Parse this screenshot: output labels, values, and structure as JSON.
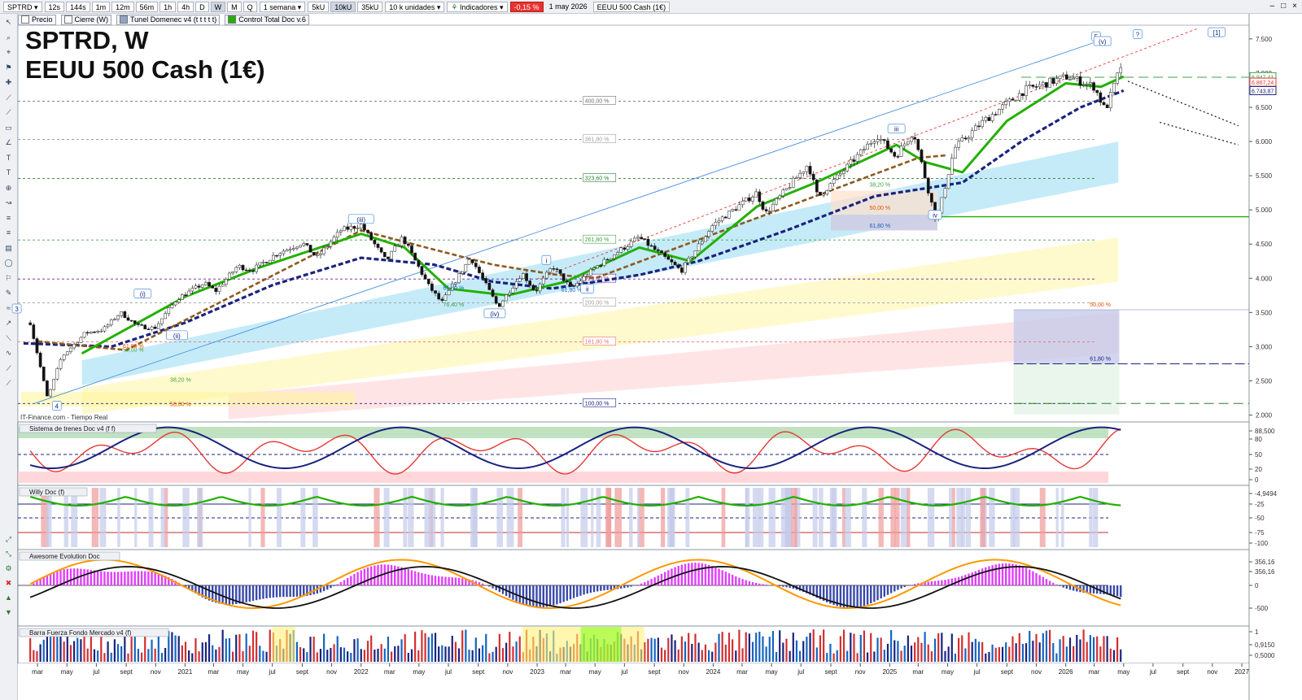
{
  "toolbar": {
    "symbol": "SPTRD",
    "timeframes": [
      "12s",
      "144s",
      "1m",
      "12m",
      "56m",
      "1h",
      "4h",
      "D",
      "W",
      "M",
      "Q"
    ],
    "period": "1 semana",
    "units": [
      "5kU",
      "10kU",
      "35kU"
    ],
    "quantity": "10 k unidades",
    "indicators": "Indicadores",
    "change": "-0,15 %",
    "date": "1 may 2026",
    "instrument": "EEUU 500 Cash (1€)"
  },
  "legend": {
    "items": [
      "Precio",
      "Cierre (W)",
      "Tunel Domenec v4 (t t t t t)",
      "Control Total Doc v.6"
    ]
  },
  "title": {
    "line1": "SPTRD, W",
    "line2": "EEUU 500 Cash (1€)"
  },
  "watermark": "IT-Finance.com - Tiempo Real",
  "panels": {
    "p1": "Sistema de trenes Doc v4 (f f)",
    "p2": "Willy Doc (f)",
    "p3": "Awesome Evolution Doc",
    "p4": "Barra Fuerza Fondo Mercado v4 (f)"
  },
  "colors": {
    "price_up": "#2e7d32",
    "price_down": "#c62828",
    "tunnel_green": "#22b000",
    "tunnel_red": "#e53935",
    "tunnel_blue": "#1a237e",
    "brown": "#8d5a1f",
    "fib_green": "#2e7d32",
    "fib_gray": "#707070",
    "accent_red": "#e8322f"
  },
  "chart_data": {
    "type": "candlestick",
    "timeframe": "W",
    "x_labels": [
      "mar",
      "may",
      "jul",
      "sept",
      "nov",
      "2021",
      "mar",
      "may",
      "jul",
      "sept",
      "nov",
      "2022",
      "mar",
      "may",
      "jul",
      "sept",
      "nov",
      "2023",
      "mar",
      "may",
      "jul",
      "sept",
      "nov",
      "2024",
      "mar",
      "may",
      "jul",
      "sept",
      "nov",
      "2025",
      "mar",
      "may",
      "jul",
      "sept",
      "nov",
      "2026",
      "mar",
      "may",
      "jul",
      "sept",
      "nov",
      "2027"
    ],
    "y_ticks": [
      "7.500",
      "7.000",
      "6.500",
      "6.000",
      "5.500",
      "5.000",
      "4.500",
      "4.000",
      "3.500",
      "3.000",
      "2.500",
      "2.000"
    ],
    "ylim": [
      1900,
      7700
    ],
    "price_path": [
      [
        "2020-02-15",
        3350
      ],
      [
        "2020-03-22",
        2240
      ],
      [
        "2020-04-20",
        2850
      ],
      [
        "2020-06-08",
        3200
      ],
      [
        "2020-07-15",
        3250
      ],
      [
        "2020-08-20",
        3500
      ],
      [
        "2020-09-25",
        3300
      ],
      [
        "2020-10-30",
        3270
      ],
      [
        "2020-12-15",
        3700
      ],
      [
        "2021-02-10",
        3930
      ],
      [
        "2021-03-05",
        3810
      ],
      [
        "2021-04-20",
        4180
      ],
      [
        "2021-05-20",
        4120
      ],
      [
        "2021-07-10",
        4360
      ],
      [
        "2021-09-01",
        4520
      ],
      [
        "2021-10-01",
        4300
      ],
      [
        "2021-11-20",
        4700
      ],
      [
        "2022-01-01",
        4780
      ],
      [
        "2022-02-22",
        4250
      ],
      [
        "2022-03-28",
        4600
      ],
      [
        "2022-05-20",
        3900
      ],
      [
        "2022-06-17",
        3640
      ],
      [
        "2022-08-16",
        4310
      ],
      [
        "2022-10-12",
        3580
      ],
      [
        "2022-12-01",
        4080
      ],
      [
        "2022-12-28",
        3800
      ],
      [
        "2023-02-02",
        4180
      ],
      [
        "2023-03-13",
        3850
      ],
      [
        "2023-04-30",
        4150
      ],
      [
        "2023-07-31",
        4600
      ],
      [
        "2023-10-27",
        4110
      ],
      [
        "2023-12-31",
        4780
      ],
      [
        "2024-03-31",
        5250
      ],
      [
        "2024-04-19",
        4950
      ],
      [
        "2024-07-16",
        5670
      ],
      [
        "2024-08-05",
        5180
      ],
      [
        "2024-12-06",
        6090
      ],
      [
        "2025-01-13",
        5780
      ],
      [
        "2025-02-19",
        6150
      ],
      [
        "2025-04-08",
        4820
      ],
      [
        "2025-05-15",
        5900
      ],
      [
        "2025-07-15",
        6300
      ],
      [
        "2025-10-08",
        6750
      ],
      [
        "2026-01-05",
        6950
      ],
      [
        "2026-03-01",
        6800
      ],
      [
        "2026-03-24",
        6450
      ],
      [
        "2026-04-08",
        6750
      ],
      [
        "2026-05-01",
        7220
      ]
    ],
    "tunnel": {
      "green_ema": [
        [
          "2020-06-01",
          2900
        ],
        [
          "2021-01-01",
          3730
        ],
        [
          "2021-06-01",
          4150
        ],
        [
          "2022-01-01",
          4650
        ],
        [
          "2022-04-01",
          4450
        ],
        [
          "2022-07-01",
          3850
        ],
        [
          "2022-11-01",
          3750
        ],
        [
          "2023-03-01",
          3950
        ],
        [
          "2023-08-01",
          4450
        ],
        [
          "2023-11-15",
          4250
        ],
        [
          "2024-04-01",
          5050
        ],
        [
          "2024-08-01",
          5400
        ],
        [
          "2025-01-15",
          5950
        ],
        [
          "2025-03-15",
          5700
        ],
        [
          "2025-06-01",
          5550
        ],
        [
          "2025-09-01",
          6300
        ],
        [
          "2026-01-01",
          6850
        ],
        [
          "2026-03-15",
          6800
        ],
        [
          "2026-05-01",
          6950
        ]
      ],
      "blue_sma": [
        [
          "2020-02-01",
          3050
        ],
        [
          "2020-08-01",
          3000
        ],
        [
          "2021-01-01",
          3350
        ],
        [
          "2021-07-01",
          3900
        ],
        [
          "2022-01-01",
          4300
        ],
        [
          "2022-06-01",
          4200
        ],
        [
          "2022-10-01",
          3950
        ],
        [
          "2023-02-01",
          3850
        ],
        [
          "2023-08-01",
          4050
        ],
        [
          "2023-12-01",
          4250
        ],
        [
          "2024-06-01",
          4700
        ],
        [
          "2024-12-01",
          5200
        ],
        [
          "2025-06-01",
          5400
        ],
        [
          "2025-10-01",
          6000
        ],
        [
          "2026-02-01",
          6500
        ],
        [
          "2026-05-01",
          6744
        ]
      ],
      "brown_ma": [
        [
          "2020-03-01",
          3080
        ],
        [
          "2020-09-01",
          2950
        ],
        [
          "2022-01-01",
          4700
        ],
        [
          "2022-06-01",
          4420
        ],
        [
          "2022-10-01",
          4200
        ],
        [
          "2023-02-01",
          4060
        ],
        [
          "2023-05-01",
          4000
        ],
        [
          "2025-03-01",
          5760
        ],
        [
          "2025-05-01",
          5800
        ]
      ]
    },
    "fib_levels": [
      {
        "label": "400,00 %",
        "value": 6590,
        "color": "#707070"
      },
      {
        "label": "361,80 %",
        "value": 6030,
        "color": "#9e9e9e"
      },
      {
        "label": "323,60 %",
        "value": 5460,
        "color": "#2e7d32"
      },
      {
        "label": "261,80 %",
        "value": 4560,
        "color": "#43a047"
      },
      {
        "label": "223,60 %",
        "value": 3990,
        "color": "#6a1b9a"
      },
      {
        "label": "200,00 %",
        "value": 3640,
        "color": "#9e9e9e"
      },
      {
        "label": "161,80 %",
        "value": 3070,
        "color": "#e57373"
      },
      {
        "label": "100,00 %",
        "value": 2170,
        "color": "#1a237e"
      }
    ],
    "extra_labels": [
      "61,80 %",
      "76,40 %",
      "38,20 %",
      "50,00 %",
      "50,00 %",
      "61,80 %",
      "38,20 %",
      "50,00 %",
      "61,80 %",
      "61,80 %"
    ],
    "wave_labels": [
      "3",
      "4",
      "(i)",
      "(ii)",
      "(iii)",
      "(iv)",
      "i",
      "ii",
      "iii",
      "iv",
      "5",
      "(v)",
      "?",
      "[1]"
    ],
    "right_labels": [
      "6.947,41",
      "6.867,24",
      "6.743,87"
    ],
    "target_green": 4900,
    "zones_right": {
      "top": 3540,
      "mid": 2750,
      "bottom": 2170,
      "labels": [
        "50,00 %",
        "61,80 %"
      ]
    },
    "osc_ticks": {
      "p1": [
        "88,500",
        "80",
        "50",
        "20",
        "0"
      ],
      "p2": [
        "-4,9494",
        "-25",
        "-50",
        "-75",
        "-100"
      ],
      "p3": [
        "356,16",
        "356,16",
        "0",
        "-500"
      ],
      "p4": [
        "1",
        "0,9150",
        "0,5000"
      ]
    }
  }
}
